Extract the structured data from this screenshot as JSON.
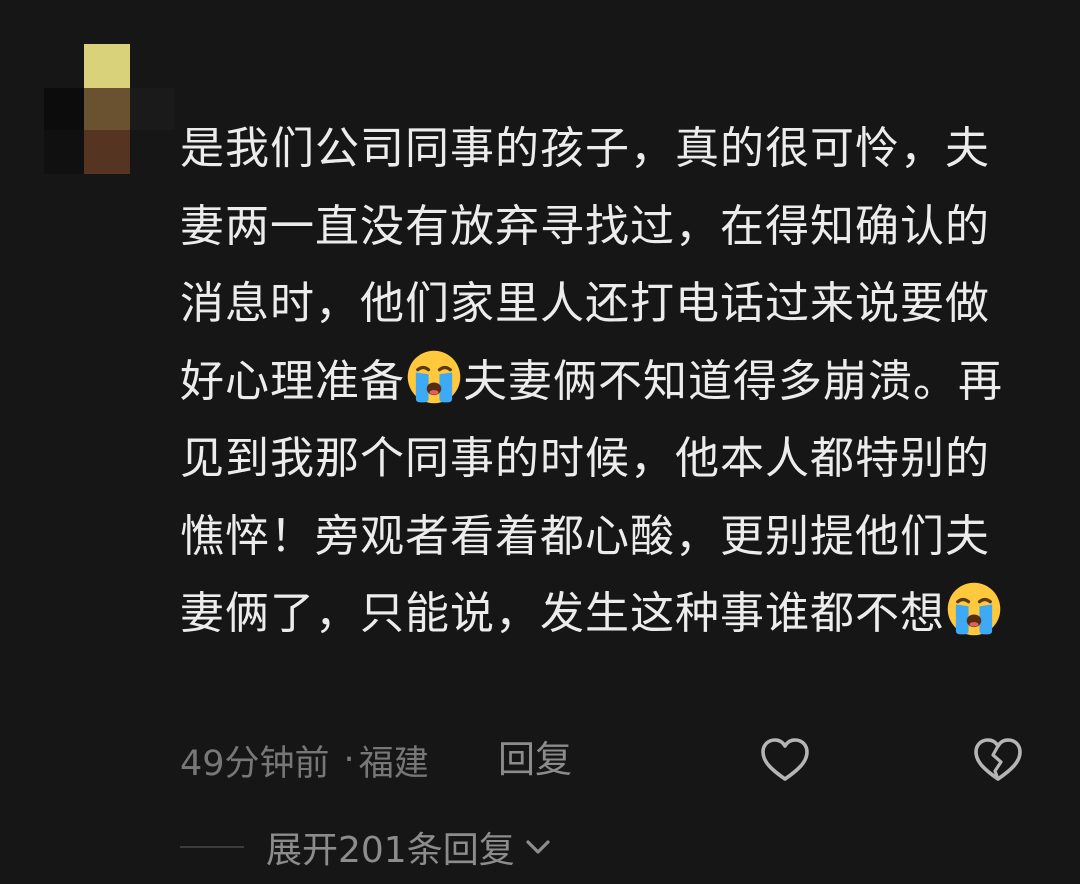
{
  "comment": {
    "username": "",
    "lines": [
      {
        "text": "是我们公司同事的孩子，真的很可怜，夫"
      },
      {
        "text": "妻两一直没有放弃寻找过，在得知确认的"
      },
      {
        "text": "消息时，他们家里人还打电话过来说要做"
      },
      {
        "text": "好心理准备",
        "emoji": "crying-face",
        "after": "夫妻俩不知道得多崩溃。再"
      },
      {
        "text": "见到我那个同事的时候，他本人都特别的"
      },
      {
        "text": "憔悴！旁观者看着都心酸，更别提他们夫"
      },
      {
        "text": "妻俩了，只能说，发生这种事谁都不想",
        "emoji": "crying-face"
      }
    ],
    "time": "49分钟前",
    "separator": "·",
    "location": "福建",
    "reply_label": "回复",
    "expand_label": "展开201条回复"
  },
  "icons": {
    "like": "heart-outline-icon",
    "dislike": "broken-heart-icon",
    "expand": "chevron-down-icon",
    "emoji": "crying-face-emoji"
  },
  "colors": {
    "background": "#161616",
    "text": "#ececec",
    "meta": "#777777",
    "action": "#8c8c8c",
    "emoji_face": "#ffc83d",
    "emoji_tears": "#3ea9f5"
  }
}
